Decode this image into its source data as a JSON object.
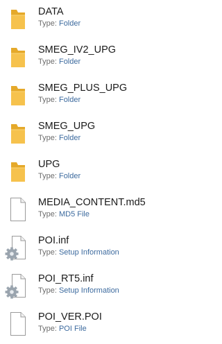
{
  "file_list": {
    "type_prefix": "Type:",
    "items": [
      {
        "name": "DATA",
        "type": "Folder",
        "icon": "folder-icon"
      },
      {
        "name": "SMEG_IV2_UPG",
        "type": "Folder",
        "icon": "folder-icon"
      },
      {
        "name": "SMEG_PLUS_UPG",
        "type": "Folder",
        "icon": "folder-icon"
      },
      {
        "name": "SMEG_UPG",
        "type": "Folder",
        "icon": "folder-icon"
      },
      {
        "name": "UPG",
        "type": "Folder",
        "icon": "folder-icon"
      },
      {
        "name": "MEDIA_CONTENT.md5",
        "type": "MD5 File",
        "icon": "file-icon"
      },
      {
        "name": "POI.inf",
        "type": "Setup Information",
        "icon": "setup-information-icon"
      },
      {
        "name": "POI_RT5.inf",
        "type": "Setup Information",
        "icon": "setup-information-icon"
      },
      {
        "name": "POI_VER.POI",
        "type": "POI File",
        "icon": "file-icon"
      }
    ]
  },
  "colors": {
    "background": "#ffffff",
    "name_text": "#1a1a1a",
    "type_label": "#6d6d6d",
    "type_value": "#3c6a9e",
    "folder_front": "#f6c24d",
    "folder_back": "#e5a92a"
  }
}
